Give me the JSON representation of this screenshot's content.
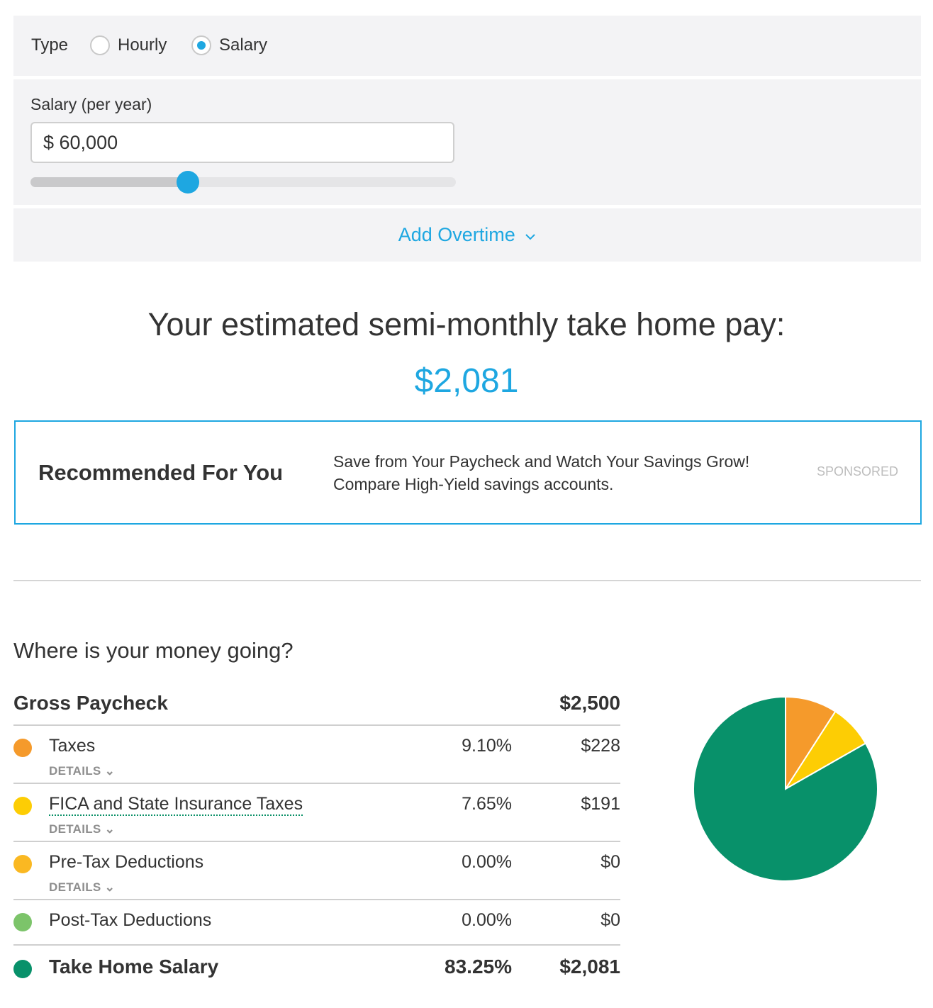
{
  "type_selector": {
    "label": "Type",
    "options": [
      {
        "label": "Hourly",
        "selected": false
      },
      {
        "label": "Salary",
        "selected": true
      }
    ]
  },
  "salary": {
    "label": "Salary (per year)",
    "value": "$ 60,000",
    "slider_fraction": 0.37
  },
  "overtime": {
    "label": "Add Overtime",
    "icon": "chevron-down-icon"
  },
  "result": {
    "heading": "Your estimated semi-monthly take home pay:",
    "amount": "$2,081"
  },
  "recommended": {
    "title": "Recommended For You",
    "line1": "Save from Your Paycheck and Watch Your Savings Grow!",
    "line2": "Compare High-Yield savings accounts.",
    "badge": "SPONSORED"
  },
  "breakdown": {
    "title": "Where is your money going?",
    "gross_label": "Gross Paycheck",
    "gross_value": "$2,500",
    "details_label": "DETAILS",
    "rows": [
      {
        "name": "Taxes",
        "pct": "9.10%",
        "value": "$228",
        "color": "#f59a2b",
        "details": true
      },
      {
        "name": "FICA and State Insurance Taxes",
        "pct": "7.65%",
        "value": "$191",
        "color": "#fdcd04",
        "details": true
      },
      {
        "name": "Pre-Tax Deductions",
        "pct": "0.00%",
        "value": "$0",
        "color": "#fab822",
        "details": true
      },
      {
        "name": "Post-Tax Deductions",
        "pct": "0.00%",
        "value": "$0",
        "color": "#7cc46a",
        "details": false
      }
    ],
    "total": {
      "name": "Take Home Salary",
      "pct": "83.25%",
      "value": "$2,081",
      "color": "#08916a"
    }
  },
  "chart_data": {
    "type": "pie",
    "title": "",
    "categories": [
      "Taxes",
      "FICA and State Insurance Taxes",
      "Pre-Tax Deductions",
      "Post-Tax Deductions",
      "Take Home Salary"
    ],
    "values": [
      9.1,
      7.65,
      0.0,
      0.0,
      83.25
    ],
    "colors": [
      "#f59a2b",
      "#fdcd04",
      "#fab822",
      "#7cc46a",
      "#08916a"
    ],
    "unit": "%"
  }
}
